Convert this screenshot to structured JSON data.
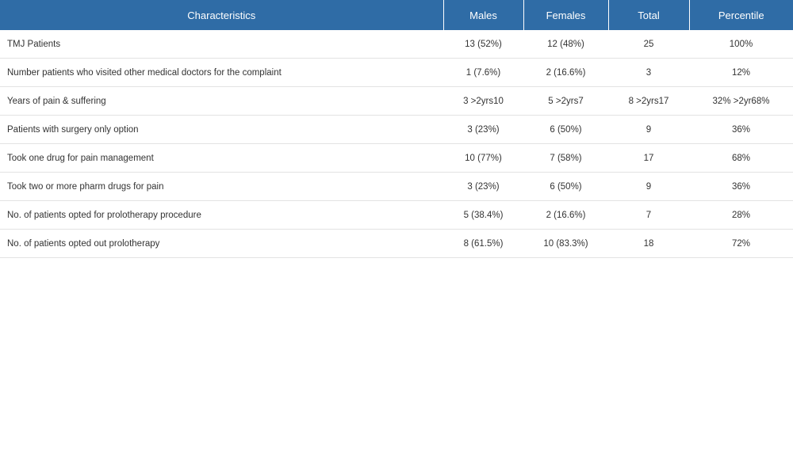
{
  "table": {
    "headers": [
      "Characteristics",
      "Males",
      "Females",
      "Total",
      "Percentile"
    ],
    "rows": [
      {
        "label": "TMJ Patients",
        "males": "13 (52%)",
        "females": "12 (48%)",
        "total": "25",
        "percentile": "100%"
      },
      {
        "label": "Number patients who visited other medical doctors for the complaint",
        "males": "1 (7.6%)",
        "females": "2 (16.6%)",
        "total": "3",
        "percentile": "12%"
      },
      {
        "label": "Years of pain & suffering",
        "males": "3 >2yrs10",
        "females": "5 >2yrs7",
        "total": "8 >2yrs17",
        "percentile": "32% >2yr68%"
      },
      {
        "label": "Patients with surgery only option",
        "males": "3 (23%)",
        "females": "6 (50%)",
        "total": "9",
        "percentile": "36%"
      },
      {
        "label": "Took one drug for pain management",
        "males": "10 (77%)",
        "females": "7 (58%)",
        "total": "17",
        "percentile": "68%"
      },
      {
        "label": "Took two or more pharm drugs for pain",
        "males": "3 (23%)",
        "females": "6 (50%)",
        "total": "9",
        "percentile": "36%"
      },
      {
        "label": "No. of patients opted for prolotherapy procedure",
        "males": "5 (38.4%)",
        "females": "2 (16.6%)",
        "total": "7",
        "percentile": "28%"
      },
      {
        "label": "No. of patients opted out prolotherapy",
        "males": "8 (61.5%)",
        "females": "10 (83.3%)",
        "total": "18",
        "percentile": "72%"
      }
    ]
  },
  "colors": {
    "header_bg": "#2f6ca6",
    "header_text": "#ffffff",
    "row_divider": "#e3e3e3"
  }
}
